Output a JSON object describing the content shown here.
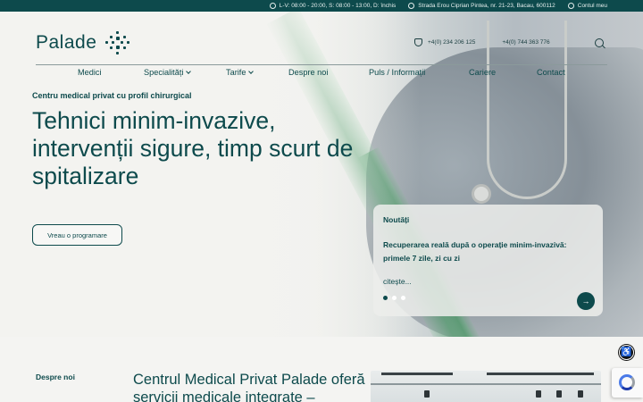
{
  "topbar": {
    "hours": "L-V: 08:00 - 20:00, S: 08:00 - 13:00, D: închis",
    "address": "Strada Erou Ciprian Pintea, nr. 21-23, Bacau, 600112",
    "account": "Contul meu"
  },
  "header": {
    "logo": "Palade",
    "phone1": "+4(0) 234 206 125",
    "phone2": "+4(0) 744 363 776"
  },
  "nav": {
    "items": [
      "Medici",
      "Specialități",
      "Tarife",
      "Despre noi",
      "Puls / Informații",
      "Cariere",
      "Contact"
    ]
  },
  "hero": {
    "kicker": "Centru medical privat cu profil chirurgical",
    "title": "Tehnici minim-invazive, intervenții sigure, timp scurt de spitalizare",
    "cta": "Vreau o programare"
  },
  "news": {
    "title": "Noutăți",
    "headline": "Recuperarea reală după o operație minim-invazivă: primele 7 zile, zi cu zi",
    "more": "citește...",
    "slides_total": 3,
    "active_slide": 1,
    "next_icon": "→"
  },
  "about": {
    "label": "Despre noi",
    "heading": "Centrul Medical Privat Palade oferă servicii medicale integrate –"
  },
  "widgets": {
    "accessibility_icon": "accessibility-icon",
    "recaptcha_icon": "recaptcha-icon"
  },
  "colors": {
    "brand": "#0d4a4c",
    "topbar": "#0d4a4c",
    "background": "#f4f4f2"
  }
}
